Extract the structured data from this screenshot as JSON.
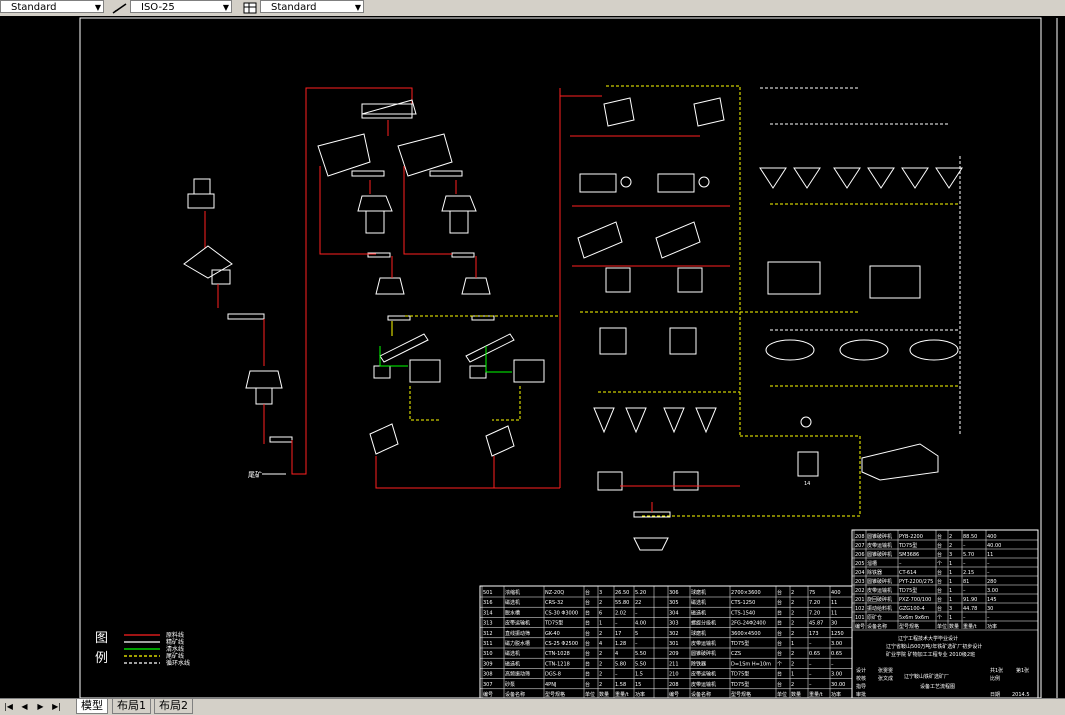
{
  "toolbar": {
    "text_style": "Standard",
    "dim_style": "ISO-25",
    "table_style": "Standard"
  },
  "drawing": {
    "labels": {
      "tailings": "尾矿",
      "pump_no": "14"
    },
    "legend": {
      "title_1": "图",
      "title_2": "例",
      "items": [
        "原料线",
        "精矿线",
        "清水线",
        "尾矿线",
        "循环水线"
      ],
      "line_colors": [
        "#ff2020",
        "#ffffff",
        "#00ff00",
        "#ffff00",
        "#ffffff"
      ]
    },
    "title_block": {
      "line1": "辽宁工程技术大学毕业设计",
      "line2": "辽宁省鞍山500万吨/年铁矿选矿厂初步设计",
      "line3": "矿业学院 矿物加工工程专业 2010级2班",
      "line4": "辽宁鞍山铁矿选矿厂",
      "line5": "设备工艺流程图",
      "fields": {
        "design": "设计",
        "check": "校核",
        "guide": "指导",
        "approve": "审批",
        "designer": "张雯雯",
        "checker": "张文成",
        "scale": "比例",
        "sheets_total": "共1张",
        "sheet_no": "第1张",
        "date_label": "日期",
        "date": "2014.5"
      }
    },
    "upper_table": {
      "rows": [
        [
          "208",
          "圆锥破碎机",
          "PYB-2200",
          "台",
          "2",
          "88.50",
          "400"
        ],
        [
          "207",
          "皮带运输机",
          "TD75型",
          "台",
          "2",
          "–",
          "40.00"
        ],
        [
          "206",
          "圆锥破碎机",
          "SM3686",
          "台",
          "3",
          "5.70",
          "11"
        ],
        [
          "205",
          "溜槽",
          "–",
          "个",
          "1",
          "–",
          "–"
        ],
        [
          "204",
          "除铁器",
          "CT-614",
          "台",
          "1",
          "2.15",
          "–"
        ],
        [
          "203",
          "圆锥破碎机",
          "PYT-2200/275",
          "台",
          "1",
          "81",
          "280"
        ],
        [
          "202",
          "皮带运输机",
          "TD75型",
          "台",
          "1",
          "–",
          "3.00"
        ],
        [
          "201",
          "旋回破碎机",
          "PXZ-700/100",
          "台",
          "1",
          "91.90",
          "145"
        ],
        [
          "102",
          "振动给料机",
          "GZG100-4",
          "台",
          "3",
          "44.78",
          "30"
        ],
        [
          "101",
          "原矿仓",
          "5x6m 9x6m",
          "个",
          "1",
          "–",
          "–"
        ]
      ],
      "header": [
        "编号",
        "设备名称",
        "型号规格",
        "单位",
        "数量",
        "重量/t",
        "功率"
      ]
    },
    "lower_table": {
      "left_rows": [
        [
          "501",
          "浓缩机",
          "NZ-20Q",
          "台",
          "3",
          "26.50",
          "5.20"
        ],
        [
          "316",
          "磁选机",
          "CRS-32",
          "台",
          "2",
          "55.80",
          "22"
        ],
        [
          "314",
          "脱水槽",
          "CS-30 Φ3000",
          "台",
          "6",
          "2.02",
          "–"
        ],
        [
          "313",
          "皮带运输机",
          "TD75型",
          "台",
          "1",
          "–",
          "4.00"
        ],
        [
          "312",
          "直线振动筛",
          "GK-40",
          "台",
          "2",
          "17",
          "5"
        ],
        [
          "311",
          "磁力脱水槽",
          "CS-25 Φ2500",
          "台",
          "4",
          "1.28",
          "–"
        ],
        [
          "310",
          "磁选机",
          "CTN-1028",
          "台",
          "2",
          "4",
          "5.50"
        ],
        [
          "309",
          "磁选机",
          "CTN-1218",
          "台",
          "2",
          "5.80",
          "5.50"
        ],
        [
          "308",
          "高频振动筛",
          "DGS-8",
          "台",
          "2",
          "–",
          "1.5"
        ],
        [
          "307",
          "砂泵",
          "4PNJ",
          "台",
          "2",
          "1.58",
          "15"
        ]
      ],
      "right_rows": [
        [
          "306",
          "球磨机",
          "2700×3600",
          "台",
          "2",
          "75",
          "400"
        ],
        [
          "305",
          "磁选机",
          "CTS-1250",
          "台",
          "2",
          "7.20",
          "11"
        ],
        [
          "304",
          "磁选机",
          "CTS-1540",
          "台",
          "2",
          "7.20",
          "11"
        ],
        [
          "303",
          "螺旋分级机",
          "2FG-24Φ2400",
          "台",
          "2",
          "45.87",
          "30"
        ],
        [
          "302",
          "球磨机",
          "3600×4500",
          "台",
          "2",
          "173",
          "1250"
        ],
        [
          "301",
          "皮带运输机",
          "TD75型",
          "台",
          "1",
          "–",
          "3.00"
        ],
        [
          "209",
          "圆锥破碎机",
          "CZS",
          "台",
          "2",
          "0.65",
          "0.65"
        ],
        [
          "211",
          "除铁器",
          "D=1Sm H=10m",
          "个",
          "2",
          "–",
          "–"
        ],
        [
          "210",
          "皮带运输机",
          "TD75型",
          "台",
          "1",
          "–",
          "3.00"
        ],
        [
          "208",
          "皮带运输机",
          "TD75型",
          "台",
          "2",
          "–",
          "30.00"
        ]
      ],
      "header": [
        "编号",
        "设备名称",
        "型号规格",
        "单位",
        "数量",
        "重量/t",
        "功率"
      ]
    }
  },
  "tabs": {
    "items": [
      "模型",
      "布局1",
      "布局2"
    ],
    "active": "模型"
  },
  "colors": {
    "feed": "#ff2020",
    "concentrate": "#ffffff",
    "water": "#00ff00",
    "tailings": "#ffff00",
    "frame": "#ffffff",
    "toolbar_bg": "#d4d0c8"
  }
}
